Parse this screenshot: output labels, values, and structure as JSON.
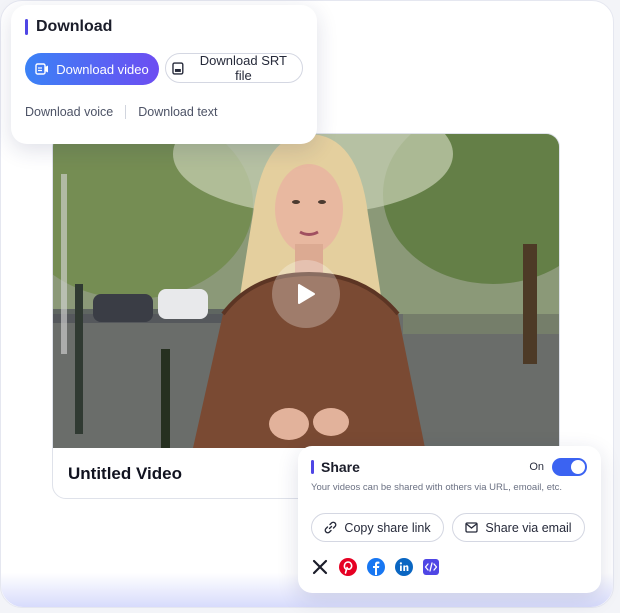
{
  "download": {
    "title": "Download",
    "video_label": "Download video",
    "srt_label": "Download SRT file",
    "voice_label": "Download voice",
    "text_label": "Download text"
  },
  "video": {
    "title": "Untitled Video"
  },
  "share": {
    "title": "Share",
    "toggle_label": "On",
    "toggle_on": true,
    "description": "Your videos can be shared with others via URL, emoail, etc.",
    "copy_label": "Copy share link",
    "email_label": "Share via email",
    "socials": [
      "x-icon",
      "pinterest-icon",
      "facebook-icon",
      "linkedin-icon",
      "embed-code-icon"
    ]
  },
  "colors": {
    "accent": "#4f46e5",
    "button_gradient_start": "#3b82f6",
    "button_gradient_end": "#6d4df2",
    "toggle": "#3b63f2",
    "pinterest": "#e60023",
    "facebook": "#1877f2",
    "linkedin": "#0a66c2",
    "embed": "#4f46e5"
  }
}
